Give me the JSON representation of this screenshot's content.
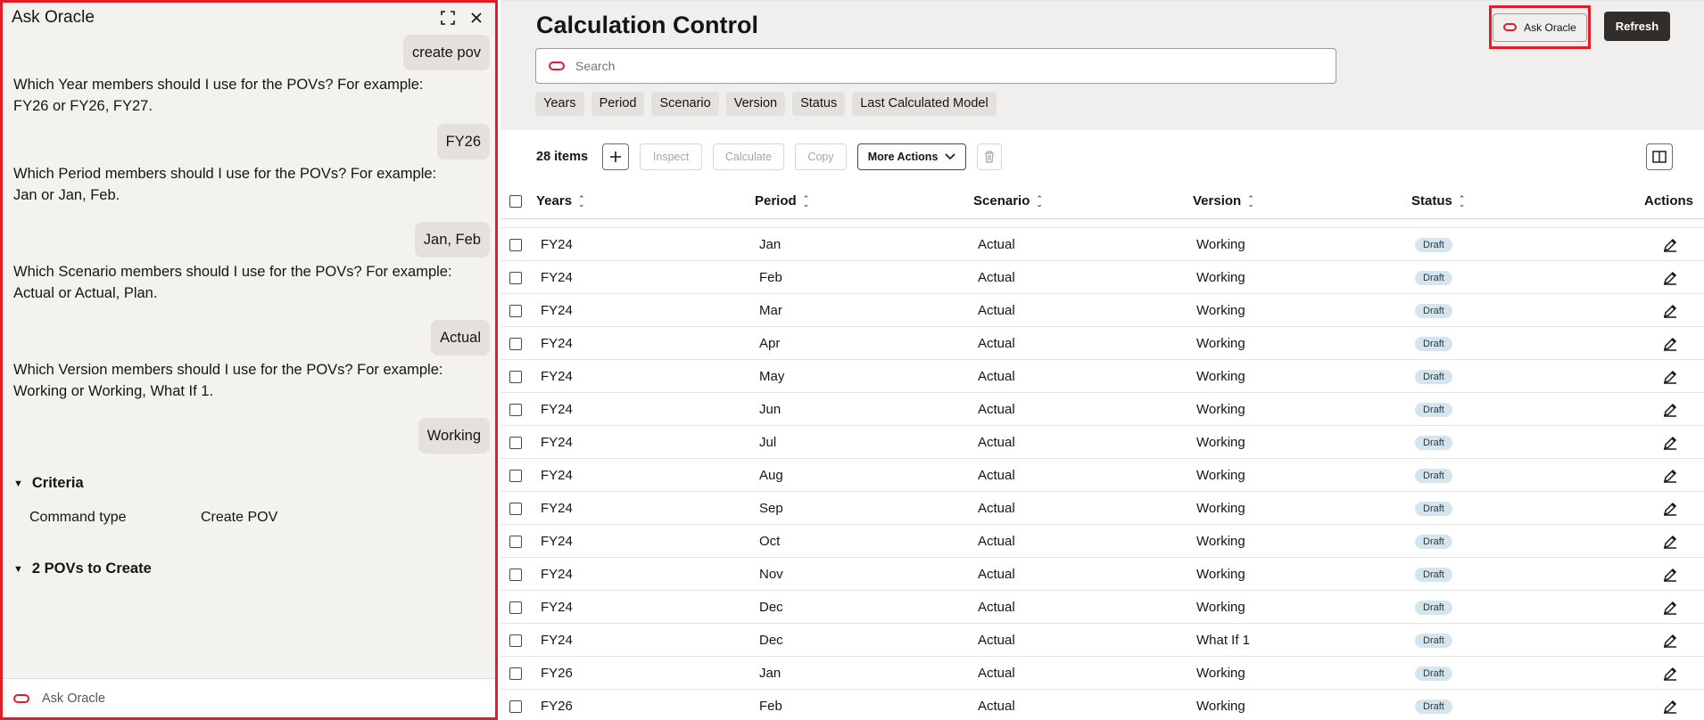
{
  "chat": {
    "title": "Ask Oracle",
    "input_placeholder": "Ask Oracle",
    "messages": [
      {
        "role": "user",
        "text": "create pov"
      },
      {
        "role": "bot",
        "text": "Which Year members should I use for the POVs? For example: FY26 or FY26, FY27."
      },
      {
        "role": "user",
        "text": "FY26"
      },
      {
        "role": "bot",
        "text": "Which Period members should I use for the POVs? For example: Jan or Jan, Feb."
      },
      {
        "role": "user",
        "text": "Jan, Feb"
      },
      {
        "role": "bot",
        "text": "Which Scenario members should I use for the POVs? For example: Actual or Actual, Plan."
      },
      {
        "role": "user",
        "text": "Actual"
      },
      {
        "role": "bot",
        "text": "Which Version members should I use for the POVs? For example: Working or Working, What If 1."
      },
      {
        "role": "user",
        "text": "Working"
      }
    ],
    "criteria": {
      "heading": "Criteria",
      "label": "Command type",
      "value": "Create POV"
    },
    "povs_heading": "2 POVs to Create"
  },
  "main": {
    "title": "Calculation Control",
    "search_placeholder": "Search",
    "filters": [
      "Years",
      "Period",
      "Scenario",
      "Version",
      "Status",
      "Last Calculated Model"
    ],
    "ask_oracle_label": "Ask Oracle",
    "refresh_label": "Refresh",
    "item_count": "28 items",
    "toolbar": {
      "inspect": "Inspect",
      "calculate": "Calculate",
      "copy": "Copy",
      "more_actions": "More Actions"
    }
  },
  "table": {
    "columns": [
      "Years",
      "Period",
      "Scenario",
      "Version",
      "Status",
      "Actions"
    ],
    "rows": [
      [
        "FY24",
        "Jan",
        "Actual",
        "Working",
        "Draft"
      ],
      [
        "FY24",
        "Feb",
        "Actual",
        "Working",
        "Draft"
      ],
      [
        "FY24",
        "Mar",
        "Actual",
        "Working",
        "Draft"
      ],
      [
        "FY24",
        "Apr",
        "Actual",
        "Working",
        "Draft"
      ],
      [
        "FY24",
        "May",
        "Actual",
        "Working",
        "Draft"
      ],
      [
        "FY24",
        "Jun",
        "Actual",
        "Working",
        "Draft"
      ],
      [
        "FY24",
        "Jul",
        "Actual",
        "Working",
        "Draft"
      ],
      [
        "FY24",
        "Aug",
        "Actual",
        "Working",
        "Draft"
      ],
      [
        "FY24",
        "Sep",
        "Actual",
        "Working",
        "Draft"
      ],
      [
        "FY24",
        "Oct",
        "Actual",
        "Working",
        "Draft"
      ],
      [
        "FY24",
        "Nov",
        "Actual",
        "Working",
        "Draft"
      ],
      [
        "FY24",
        "Dec",
        "Actual",
        "Working",
        "Draft"
      ],
      [
        "FY24",
        "Dec",
        "Actual",
        "What If 1",
        "Draft"
      ],
      [
        "FY26",
        "Jan",
        "Actual",
        "Working",
        "Draft"
      ],
      [
        "FY26",
        "Feb",
        "Actual",
        "Working",
        "Draft"
      ]
    ]
  },
  "colors": {
    "highlight": "#e11d2a",
    "primary_button": "#312d2a",
    "badge_bg": "#d4e5ee"
  }
}
